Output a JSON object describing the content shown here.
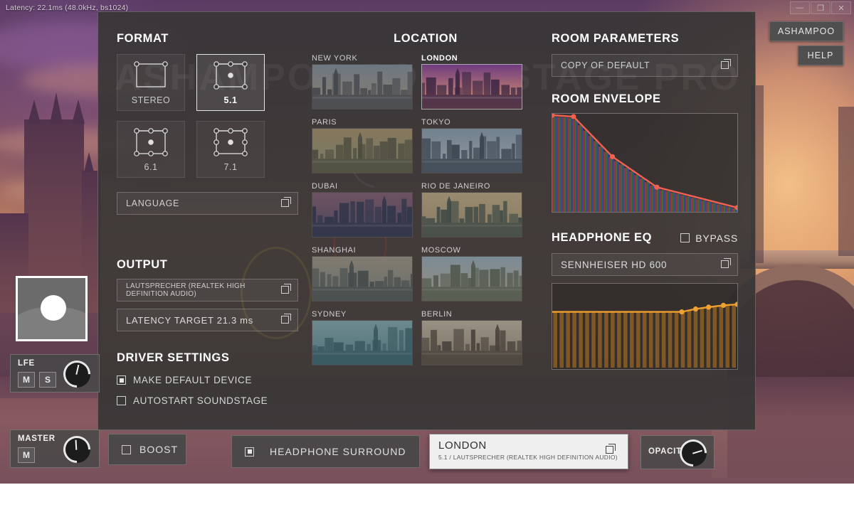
{
  "overlay": {
    "latency_text": "Latency: 22.1ms (48.0kHz, bs1024)"
  },
  "window_controls": {
    "minimize": "—",
    "maximize": "❐",
    "close": "✕"
  },
  "corner_buttons": {
    "ashampoo": "ASHAMPOO",
    "help": "HELP"
  },
  "watermark": "ASHAMPOO SOUNDSTAGE PRO",
  "format": {
    "title": "FORMAT",
    "selected": "5.1",
    "tiles": [
      {
        "label": "STEREO",
        "selected": false,
        "speakers": 2
      },
      {
        "label": "5.1",
        "selected": true,
        "speakers": 6
      },
      {
        "label": "6.1",
        "selected": false,
        "speakers": 7
      },
      {
        "label": "7.1",
        "selected": false,
        "speakers": 8
      }
    ],
    "language_label": "LANGUAGE"
  },
  "output": {
    "title": "OUTPUT",
    "device": "LAUTSPRECHER (REALTEK HIGH DEFINITION AUDIO)",
    "latency_target": "LATENCY TARGET 21.3 ms"
  },
  "driver_settings": {
    "title": "DRIVER SETTINGS",
    "options": [
      {
        "label": "MAKE DEFAULT DEVICE",
        "checked": true
      },
      {
        "label": "AUTOSTART SOUNDSTAGE",
        "checked": false
      }
    ]
  },
  "location": {
    "title": "LOCATION",
    "selected": "LONDON",
    "items": [
      {
        "name": "NEW YORK",
        "selected": false,
        "sky_a": "#8fa7bd",
        "sky_b": "#cfae8b",
        "ground": "#5b6270"
      },
      {
        "name": "LONDON",
        "selected": true,
        "sky_a": "#6b3f7a",
        "sky_b": "#f2a martinez",
        "ground": "#3a2740"
      },
      {
        "name": "PARIS",
        "selected": false,
        "sky_a": "#caa45f",
        "sky_b": "#9ab07c",
        "ground": "#6d6a4a"
      },
      {
        "name": "TOKYO",
        "selected": false,
        "sky_a": "#8fb6d8",
        "sky_b": "#c9d8e6",
        "ground": "#47607d"
      },
      {
        "name": "DUBAI",
        "selected": false,
        "sky_a": "#b06a8f",
        "sky_b": "#6a5fa0",
        "ground": "#3d4a7a"
      },
      {
        "name": "RIO DE JANEIRO",
        "selected": false,
        "sky_a": "#e0c07a",
        "sky_b": "#cfa86a",
        "ground": "#4e6a5e"
      },
      {
        "name": "SHANGHAI",
        "selected": false,
        "sky_a": "#b7ab8e",
        "sky_b": "#8f9b95",
        "ground": "#5a6b6a"
      },
      {
        "name": "MOSCOW",
        "selected": false,
        "sky_a": "#9fc3dd",
        "sky_b": "#d9c79a",
        "ground": "#6b7a5e"
      },
      {
        "name": "SYDNEY",
        "selected": false,
        "sky_a": "#7fc4cf",
        "sky_b": "#4ba8b8",
        "ground": "#2f7f90"
      },
      {
        "name": "BERLIN",
        "selected": false,
        "sky_a": "#d9c9a8",
        "sky_b": "#b59a74",
        "ground": "#6a5a4a"
      }
    ]
  },
  "room": {
    "parameters_title": "ROOM PARAMETERS",
    "preset": "COPY OF DEFAULT",
    "envelope_title": "ROOM ENVELOPE"
  },
  "headphone_eq": {
    "title": "HEADPHONE EQ",
    "bypass_label": "BYPASS",
    "bypass_checked": false,
    "preset": "SENNHEISER HD 600"
  },
  "channels": {
    "lfe": {
      "label": "LFE",
      "mute": "M",
      "solo": "S",
      "knob_deg": 58
    },
    "master": {
      "label": "MASTER",
      "mute": "M",
      "knob_deg": 42
    },
    "opacity": {
      "label": "OPACITY",
      "knob_deg": 118
    }
  },
  "bottom_bar": {
    "boost": {
      "label": "BOOST",
      "checked": false
    },
    "headphone_surround": {
      "label": "HEADPHONE SURROUND",
      "checked": true
    }
  },
  "preset_bar": {
    "title": "LONDON",
    "subtitle": "5.1 / LAUTSPRECHER (REALTEK HIGH DEFINITION AUDIO)"
  },
  "colors": {
    "envelope_line": "#f4604f",
    "eq_line": "#f0a030",
    "panel_bg": "#383636",
    "accent_white": "#ffffff"
  },
  "chart_data": [
    {
      "type": "area",
      "title": "ROOM ENVELOPE",
      "xlabel": "",
      "ylabel": "",
      "ylim": [
        0,
        1
      ],
      "grid": false,
      "nodes_x": [
        0.0,
        0.115,
        0.325,
        0.565,
        1.0
      ],
      "nodes_y": [
        1.0,
        0.985,
        0.565,
        0.245,
        0.03
      ],
      "bar_count": 36,
      "bar_palette": [
        "#b03a3a",
        "#3f7a3f",
        "#3a4fb0"
      ],
      "line_color": "#f4604f"
    },
    {
      "type": "line",
      "title": "HEADPHONE EQ",
      "xlabel": "",
      "ylabel": "",
      "ylim": [
        -1,
        1
      ],
      "grid": false,
      "nodes_x": [
        0.0,
        0.7,
        0.775,
        0.845,
        0.925,
        1.0
      ],
      "nodes_y": [
        0.0,
        0.0,
        0.115,
        0.185,
        0.255,
        0.295
      ],
      "bar_count": 29,
      "bar_color": "#c07a20",
      "line_color": "#f0a030"
    }
  ]
}
